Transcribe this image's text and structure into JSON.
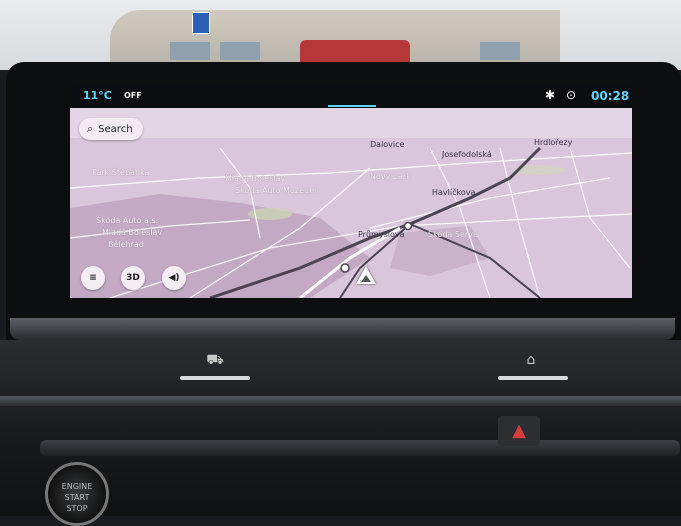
{
  "status": {
    "temperature": "11°C",
    "ac_state": "OFF",
    "bluetooth_icon": "bluetooth-icon",
    "location_icon": "location-icon",
    "time": "00:28"
  },
  "map": {
    "search_label": "Search",
    "buttons": {
      "menu": "≡",
      "view_mode": "3D",
      "volume": "◀)"
    },
    "labels": {
      "dalovice": "Dalovice",
      "josefodolska": "Josefodolská",
      "hrdlorezy": "Hrdlořezy",
      "novy_park": "Nový park",
      "havlickova": "Havlíčkova",
      "prumyslova": "Průmyslová",
      "skoda_service": "Škoda Servis",
      "park_stepanka": "Park Štěpánka",
      "mlada_boleslav_area": "Mladá Boleslav",
      "skoda_museum": "Škoda Auto Muzeum",
      "skoda_plant_1": "Škoda Auto a.s.",
      "skoda_plant_2": "Mladá Boleslav",
      "skoda_plant_3": "Bělehrad"
    }
  },
  "colors": {
    "accent": "#5fd6ff",
    "map_bg": "#d9c6da",
    "road": "#ffffff"
  }
}
